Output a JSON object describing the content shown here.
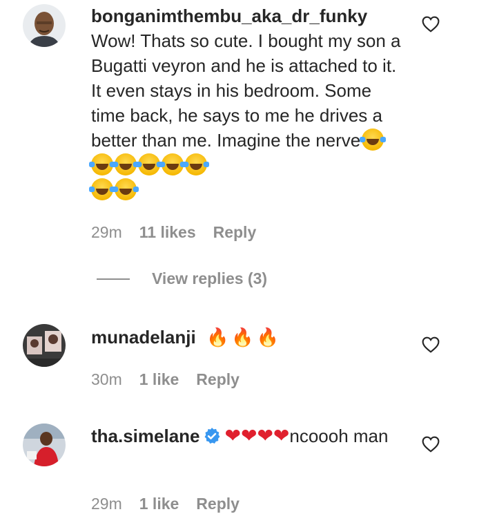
{
  "comments": [
    {
      "username": "bonganimthembu_aka_dr_funky",
      "text": "Wow! Thats so cute. I bought my son a Bugatti veyron and he is attached to it. It even stays in his bedroom. Some time back, he says to me he drives a better than me. Imagine the nerve",
      "emoji_icon": "face-with-tears-of-joy-icon",
      "emoji_count": 8,
      "time": "29m",
      "likes": "11 likes",
      "reply_label": "Reply"
    },
    {
      "username": "munadelanji",
      "text": "",
      "emoji": "🔥🔥🔥",
      "time": "30m",
      "likes": "1 like",
      "reply_label": "Reply"
    },
    {
      "username": "tha.simelane",
      "verified": true,
      "emoji": "❤❤❤❤",
      "text": "ncoooh man",
      "time": "29m",
      "likes": "1 like",
      "reply_label": "Reply"
    }
  ],
  "view_replies": "View replies (3)",
  "colors": {
    "text": "#262626",
    "meta": "#8e8e8e",
    "verified": "#3897f0",
    "background": "#ffffff"
  }
}
